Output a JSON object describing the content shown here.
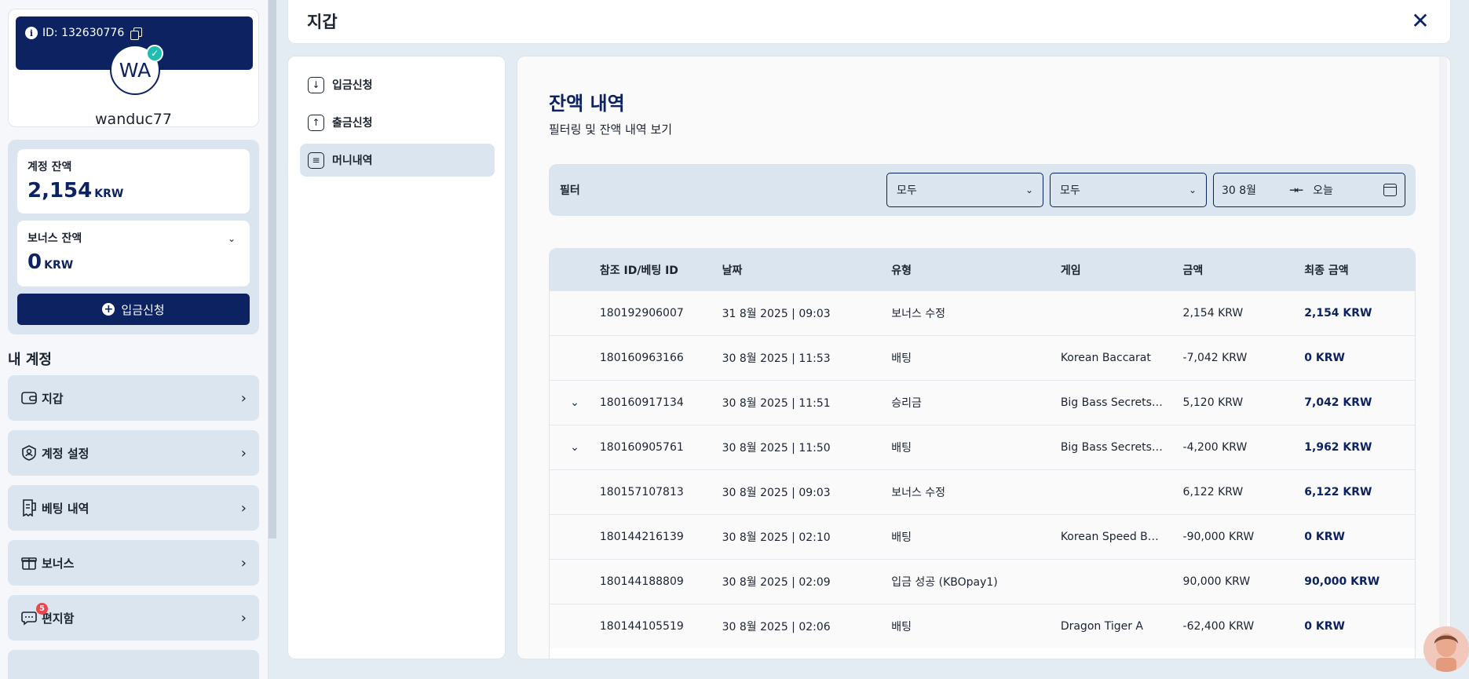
{
  "profile": {
    "id_label": "ID: 132630776",
    "avatar_initials": "WA",
    "username": "wanduc77"
  },
  "balances": {
    "account": {
      "label": "계정 잔액",
      "amount": "2,154",
      "currency": "KRW"
    },
    "bonus": {
      "label": "보너스 잔액",
      "amount": "0",
      "currency": "KRW"
    },
    "deposit_button": "입금신청"
  },
  "my_account": {
    "title": "내 계정",
    "items": [
      {
        "label": "지갑",
        "icon": "wallet-icon"
      },
      {
        "label": "계정 설정",
        "icon": "user-shield-icon"
      },
      {
        "label": "베팅 내역",
        "icon": "receipt-icon"
      },
      {
        "label": "보너스",
        "icon": "gift-icon"
      },
      {
        "label": "편지함",
        "icon": "message-icon",
        "badge": "5"
      }
    ]
  },
  "header": {
    "title": "지갑"
  },
  "submenu": {
    "items": [
      {
        "label": "입금신청",
        "icon": "download-icon"
      },
      {
        "label": "출금신청",
        "icon": "upload-icon"
      },
      {
        "label": "머니내역",
        "icon": "document-icon",
        "active": true
      }
    ]
  },
  "history": {
    "title": "잔액 내역",
    "subtitle": "필터링 및 잔액 내역 보기",
    "filter": {
      "label": "필터",
      "select1": "모두",
      "select2": "모두",
      "date_from": "30 8월",
      "date_to": "오늘"
    },
    "columns": [
      "참조 ID/베팅 ID",
      "날짜",
      "유형",
      "게임",
      "금액",
      "최종 금액"
    ],
    "rows": [
      {
        "expand": false,
        "id": "180192906007",
        "date": "31 8월 2025 | 09:03",
        "type": "보너스 수정",
        "game": "",
        "amount": "2,154 KRW",
        "final": "2,154 KRW"
      },
      {
        "expand": false,
        "id": "180160963166",
        "date": "30 8월 2025 | 11:53",
        "type": "배팅",
        "game": "Korean Baccarat",
        "amount": "-7,042 KRW",
        "final": "0 KRW"
      },
      {
        "expand": true,
        "id": "180160917134",
        "date": "30 8월 2025 | 11:51",
        "type": "승리금",
        "game": "Big Bass Secrets…",
        "amount": "5,120 KRW",
        "final": "7,042 KRW"
      },
      {
        "expand": true,
        "id": "180160905761",
        "date": "30 8월 2025 | 11:50",
        "type": "배팅",
        "game": "Big Bass Secrets…",
        "amount": "-4,200 KRW",
        "final": "1,962 KRW"
      },
      {
        "expand": false,
        "id": "180157107813",
        "date": "30 8월 2025 | 09:03",
        "type": "보너스 수정",
        "game": "",
        "amount": "6,122 KRW",
        "final": "6,122 KRW"
      },
      {
        "expand": false,
        "id": "180144216139",
        "date": "30 8월 2025 | 02:10",
        "type": "배팅",
        "game": "Korean Speed B…",
        "amount": "-90,000 KRW",
        "final": "0 KRW"
      },
      {
        "expand": false,
        "id": "180144188809",
        "date": "30 8월 2025 | 02:09",
        "type": "입금 성공 (KBOpay1)",
        "game": "",
        "amount": "90,000 KRW",
        "final": "90,000 KRW"
      },
      {
        "expand": false,
        "id": "180144105519",
        "date": "30 8월 2025 | 02:06",
        "type": "배팅",
        "game": "Dragon Tiger A",
        "amount": "-62,400 KRW",
        "final": "0 KRW"
      }
    ]
  },
  "colors": {
    "primary": "#0d2361",
    "panel": "#dbe5ef",
    "verified": "#1dbfb0",
    "badge": "#e5484d"
  }
}
